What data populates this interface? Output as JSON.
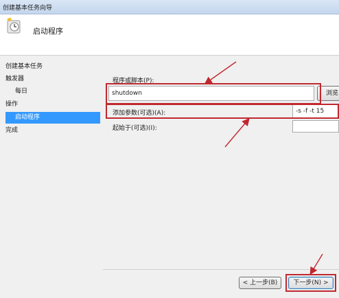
{
  "window": {
    "title": "创建基本任务向导"
  },
  "header": {
    "title": "启动程序",
    "icon": "clock-task-icon"
  },
  "sidebar": {
    "items": [
      {
        "label": "创建基本任务"
      },
      {
        "label": "触发器"
      },
      {
        "label": "每日"
      },
      {
        "label": "操作"
      },
      {
        "label": "启动程序"
      },
      {
        "label": "完成"
      }
    ]
  },
  "form": {
    "program_label": "程序或脚本(P):",
    "program_value": "shutdown",
    "browse_label": "浏览",
    "args_label": "添加参数(可选)(A):",
    "args_value": "-s -f -t 15",
    "startin_label": "起始于(可选)(I):",
    "startin_value": ""
  },
  "buttons": {
    "back": "< 上一步(B)",
    "next": "下一步(N) >"
  },
  "colors": {
    "highlight_red": "#c0282f",
    "selection_blue": "#3399ff"
  }
}
